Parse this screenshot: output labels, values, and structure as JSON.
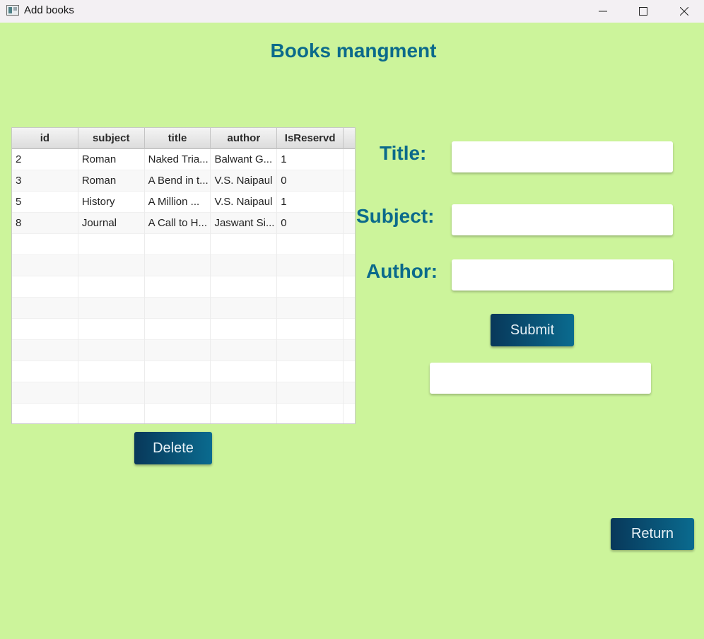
{
  "window": {
    "title": "Add books"
  },
  "page": {
    "title": "Books mangment"
  },
  "table": {
    "columns": [
      "id",
      "subject",
      "title",
      "author",
      "IsReservd"
    ],
    "rows": [
      [
        "2",
        "Roman",
        "Naked Tria...",
        "Balwant G...",
        "1"
      ],
      [
        "3",
        "Roman",
        "A Bend in t...",
        "V.S. Naipaul",
        "0"
      ],
      [
        "5",
        "History",
        "A Million ...",
        "V.S. Naipaul",
        "1"
      ],
      [
        "8",
        "Journal",
        "A Call to H...",
        "Jaswant Si...",
        "0"
      ]
    ]
  },
  "buttons": {
    "delete": "Delete",
    "submit": "Submit",
    "return": "Return"
  },
  "form": {
    "title_label": "Title:",
    "title_value": "",
    "subject_label": "Subject:",
    "subject_value": "",
    "author_label": "Author:",
    "author_value": "",
    "message_value": ""
  }
}
